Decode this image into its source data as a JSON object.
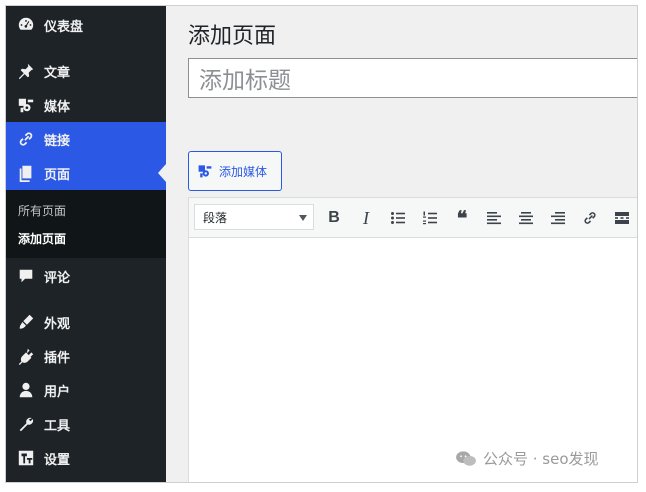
{
  "sidebar": {
    "items": [
      {
        "label": "仪表盘",
        "icon": "dashboard-icon"
      },
      {
        "label": "文章",
        "icon": "pushpin-icon"
      },
      {
        "label": "媒体",
        "icon": "media-icon"
      },
      {
        "label": "链接",
        "icon": "link-icon"
      },
      {
        "label": "页面",
        "icon": "page-icon"
      },
      {
        "label": "评论",
        "icon": "comment-icon"
      },
      {
        "label": "外观",
        "icon": "brush-icon"
      },
      {
        "label": "插件",
        "icon": "plugin-icon"
      },
      {
        "label": "用户",
        "icon": "user-icon"
      },
      {
        "label": "工具",
        "icon": "wrench-icon"
      },
      {
        "label": "设置",
        "icon": "settings-icon"
      }
    ],
    "submenu": [
      "所有页面",
      "添加页面"
    ]
  },
  "main": {
    "page_title": "添加页面",
    "title_placeholder": "添加标题",
    "add_media_label": "添加媒体",
    "format_select": "段落"
  },
  "watermark": "公众号 · seo发现",
  "colors": {
    "sidebar_bg": "#1d2327",
    "accent": "#2c58e6",
    "submenu_bg": "#101517",
    "main_bg": "#f0f0f1"
  }
}
